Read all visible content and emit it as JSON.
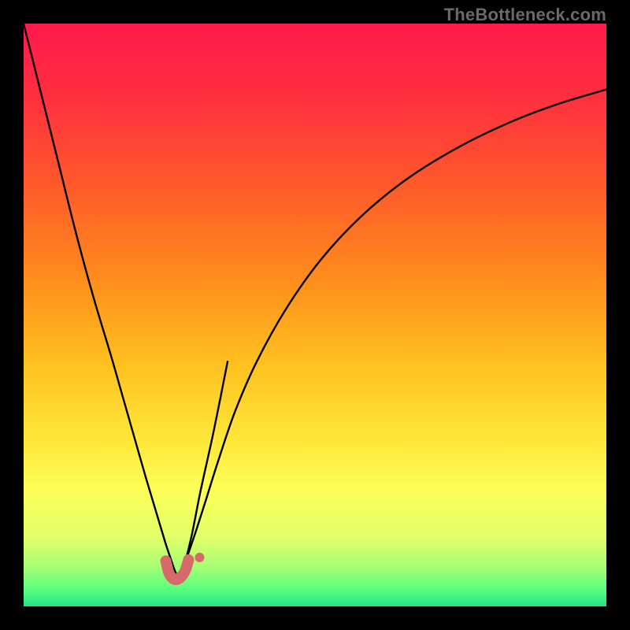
{
  "watermark": "TheBottleneck.com",
  "chart_data": {
    "type": "line",
    "title": "",
    "xlabel": "",
    "ylabel": "",
    "xlim": [
      0,
      100
    ],
    "ylim": [
      0,
      100
    ],
    "grid": false,
    "legend": false,
    "gradient_stops": [
      {
        "offset": 0.0,
        "color": "#ff1a4b"
      },
      {
        "offset": 0.12,
        "color": "#ff2e3f"
      },
      {
        "offset": 0.28,
        "color": "#ff5a2a"
      },
      {
        "offset": 0.43,
        "color": "#ff8a1d"
      },
      {
        "offset": 0.58,
        "color": "#ffbf1f"
      },
      {
        "offset": 0.72,
        "color": "#ffe93a"
      },
      {
        "offset": 0.8,
        "color": "#fcff58"
      },
      {
        "offset": 0.88,
        "color": "#e3ff68"
      },
      {
        "offset": 0.93,
        "color": "#a9ff74"
      },
      {
        "offset": 0.97,
        "color": "#5cff7e"
      },
      {
        "offset": 1.0,
        "color": "#22e38a"
      }
    ],
    "series": [
      {
        "name": "left_curve",
        "stroke": "#000000",
        "x": [
          0,
          3,
          6,
          9,
          12,
          15,
          17,
          19,
          21,
          22.8,
          24.3,
          25.3,
          26.0,
          26.6,
          27.5,
          28.8,
          30.4,
          32.6,
          35.0
        ],
        "y": [
          100,
          88,
          76,
          64,
          53,
          43,
          36,
          29,
          22,
          16,
          11,
          8,
          6,
          5.2,
          7,
          12,
          20,
          30,
          42
        ]
      },
      {
        "name": "right_curve",
        "stroke": "#000000",
        "x": [
          26.6,
          27.3,
          28.3,
          29.6,
          31.2,
          33.4,
          36.3,
          40.0,
          45.0,
          51.0,
          58.0,
          66.0,
          75.0,
          84.0,
          92.0,
          100.0
        ],
        "y": [
          5.2,
          6.5,
          9.2,
          13.0,
          18.0,
          25.0,
          33.5,
          42.0,
          51.0,
          59.5,
          67.0,
          73.5,
          79.0,
          83.3,
          86.3,
          88.7
        ]
      },
      {
        "name": "dip_marker",
        "stroke": "#d66a6a",
        "x": [
          24.4,
          24.9,
          25.5,
          26.1,
          26.7,
          27.3,
          27.8,
          28.3
        ],
        "y": [
          7.8,
          5.8,
          4.9,
          4.6,
          4.8,
          5.4,
          6.3,
          8.0
        ]
      }
    ],
    "dip_x": 26.6,
    "dip_y": 5.0
  }
}
